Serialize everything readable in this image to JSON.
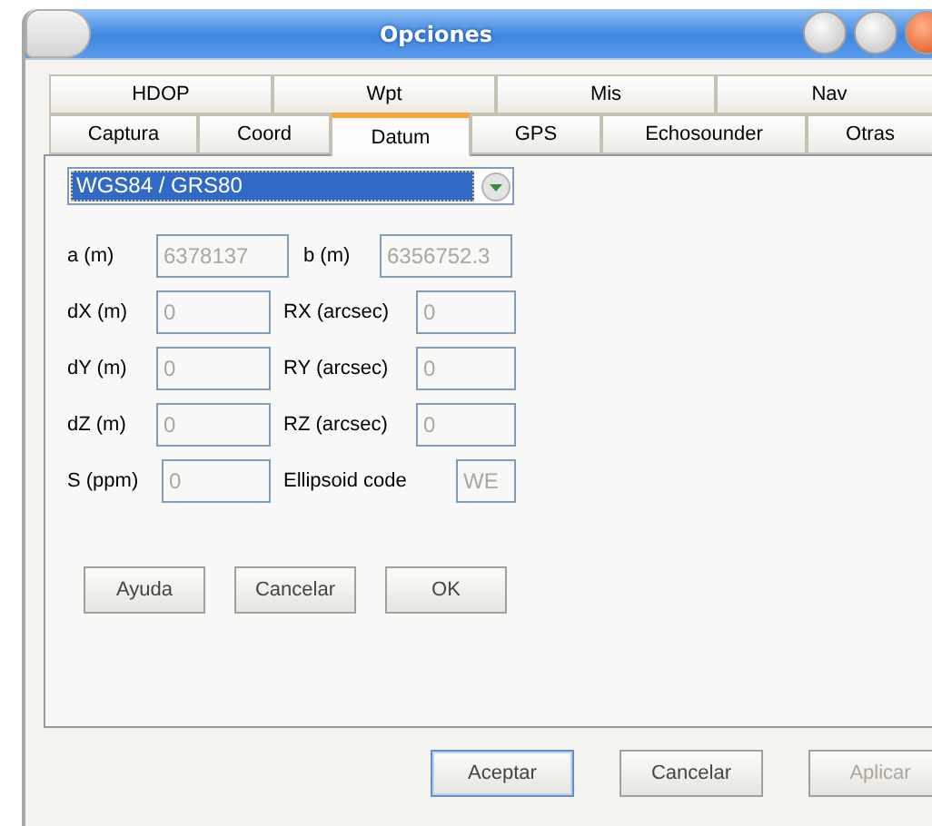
{
  "window": {
    "title": "Opciones"
  },
  "tabs": [
    [
      {
        "label": "HDOP",
        "selected": false
      },
      {
        "label": "Wpt",
        "selected": false
      },
      {
        "label": "Mis",
        "selected": false
      },
      {
        "label": "Nav",
        "selected": false
      }
    ],
    [
      {
        "label": "Captura",
        "selected": false
      },
      {
        "label": "Coord",
        "selected": false
      },
      {
        "label": "Datum",
        "selected": true
      },
      {
        "label": "GPS",
        "selected": false
      },
      {
        "label": "Echosounder",
        "selected": false
      },
      {
        "label": "Otras",
        "selected": false
      }
    ]
  ],
  "datum_select": {
    "value": "WGS84 / GRS80",
    "focused": true
  },
  "fields": [
    [
      {
        "label": "a (m)",
        "value": "6378137",
        "disabled": true
      },
      {
        "label": "b (m)",
        "value": "6356752.3",
        "disabled": true
      }
    ],
    [
      {
        "label": "dX (m)",
        "value": "0",
        "disabled": true
      },
      {
        "label": "RX (arcsec)",
        "value": "0",
        "disabled": true
      }
    ],
    [
      {
        "label": "dY (m)",
        "value": "0",
        "disabled": true
      },
      {
        "label": "RY (arcsec)",
        "value": "0",
        "disabled": true
      }
    ],
    [
      {
        "label": "dZ (m)",
        "value": "0",
        "disabled": true
      },
      {
        "label": "RZ (arcsec)",
        "value": "0",
        "disabled": true
      }
    ],
    [
      {
        "label": "S (ppm)",
        "value": "0",
        "disabled": true
      },
      {
        "label": "Ellipsoid code",
        "value": "WE",
        "disabled": true
      }
    ]
  ],
  "panel_buttons": [
    {
      "label": "Ayuda",
      "disabled": false
    },
    {
      "label": "Cancelar",
      "disabled": false
    },
    {
      "label": "OK",
      "disabled": false
    }
  ],
  "dialog_buttons": [
    {
      "label": "Aceptar",
      "default": true,
      "disabled": false
    },
    {
      "label": "Cancelar",
      "default": false,
      "disabled": false
    },
    {
      "label": "Aplicar",
      "default": false,
      "disabled": true
    }
  ]
}
